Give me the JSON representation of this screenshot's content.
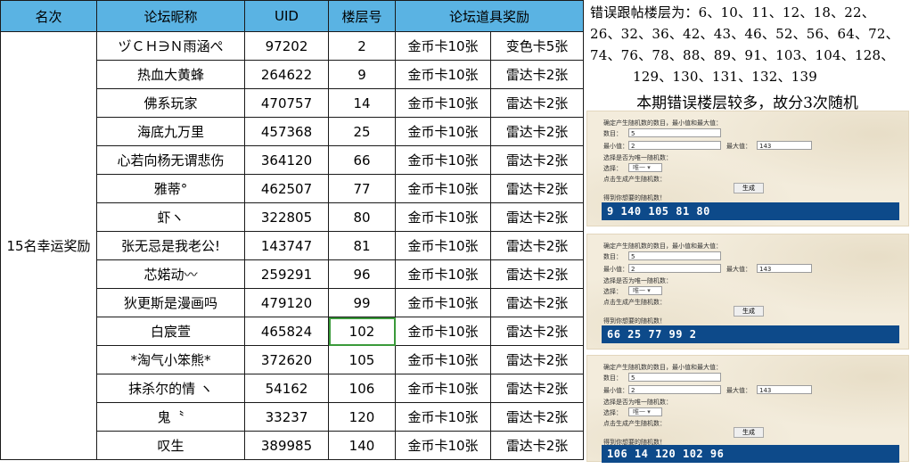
{
  "table": {
    "headers": [
      "名次",
      "论坛昵称",
      "UID",
      "楼层号",
      "论坛道具奖励"
    ],
    "rank_label": "15名幸运奖励",
    "rows": [
      {
        "name": "ヅＣＨ∋Ｎ雨涵ぺ",
        "uid": "97202",
        "floor": "2",
        "prize1": "金币卡10张",
        "prize2": "变色卡5张"
      },
      {
        "name": "热血大黄蜂",
        "uid": "264622",
        "floor": "9",
        "prize1": "金币卡10张",
        "prize2": "雷达卡2张"
      },
      {
        "name": "佛系玩家",
        "uid": "470757",
        "floor": "14",
        "prize1": "金币卡10张",
        "prize2": "雷达卡2张"
      },
      {
        "name": "海底九万里",
        "uid": "457368",
        "floor": "25",
        "prize1": "金币卡10张",
        "prize2": "雷达卡2张"
      },
      {
        "name": "心若向杨无谓悲伤",
        "uid": "364120",
        "floor": "66",
        "prize1": "金币卡10张",
        "prize2": "雷达卡2张"
      },
      {
        "name": "雅蒂°",
        "uid": "462507",
        "floor": "77",
        "prize1": "金币卡10张",
        "prize2": "雷达卡2张"
      },
      {
        "name": "虾ヽ",
        "uid": "322805",
        "floor": "80",
        "prize1": "金币卡10张",
        "prize2": "雷达卡2张"
      },
      {
        "name": "张无忌是我老公!",
        "uid": "143747",
        "floor": "81",
        "prize1": "金币卡10张",
        "prize2": "雷达卡2张"
      },
      {
        "name": "芯婼动〰",
        "uid": "259291",
        "floor": "96",
        "prize1": "金币卡10张",
        "prize2": "雷达卡2张"
      },
      {
        "name": "狄更斯是漫画吗",
        "uid": "479120",
        "floor": "99",
        "prize1": "金币卡10张",
        "prize2": "雷达卡2张"
      },
      {
        "name": "白宸萱",
        "uid": "465824",
        "floor": "102",
        "prize1": "金币卡10张",
        "prize2": "雷达卡2张"
      },
      {
        "name": "*淘气小笨熊*",
        "uid": "372620",
        "floor": "105",
        "prize1": "金币卡10张",
        "prize2": "雷达卡2张"
      },
      {
        "name": "抹杀尔的情 ヽ",
        "uid": "54162",
        "floor": "106",
        "prize1": "金币卡10张",
        "prize2": "雷达卡2张"
      },
      {
        "name": "鬼〝",
        "uid": "33237",
        "floor": "120",
        "prize1": "金币卡10张",
        "prize2": "雷达卡2张"
      },
      {
        "name": "叹生",
        "uid": "389985",
        "floor": "140",
        "prize1": "金币卡10张",
        "prize2": "雷达卡2张"
      }
    ]
  },
  "panel": {
    "error_lines": [
      "错误跟帖楼层为：6、10、11、12、18、22、",
      "26、32、36、42、43、46、52、56、64、72、",
      "74、76、78、88、89、91、103、104、128、",
      "129、130、131、132、139"
    ],
    "note": "本期错误楼层较多，故分3次随机",
    "generator": {
      "intro": "确定产生随机数的数目，最小值和最大值：",
      "count_label": "数目：",
      "count_value": "5",
      "min_label": "最小值：",
      "min_value": "2",
      "max_label": "最大值：",
      "max_value": "143",
      "unique_question": "选择是否为唯一随机数：",
      "choose_label": "选择：",
      "choose_value": "唯一",
      "click_hint": "点击生成产生随机数：",
      "generate_button": "生成",
      "result_label": "得到你想要的随机数！",
      "results": [
        "9 140 105 81 80",
        "66 25 77 99 2",
        "106 14 120 102 96"
      ]
    }
  }
}
